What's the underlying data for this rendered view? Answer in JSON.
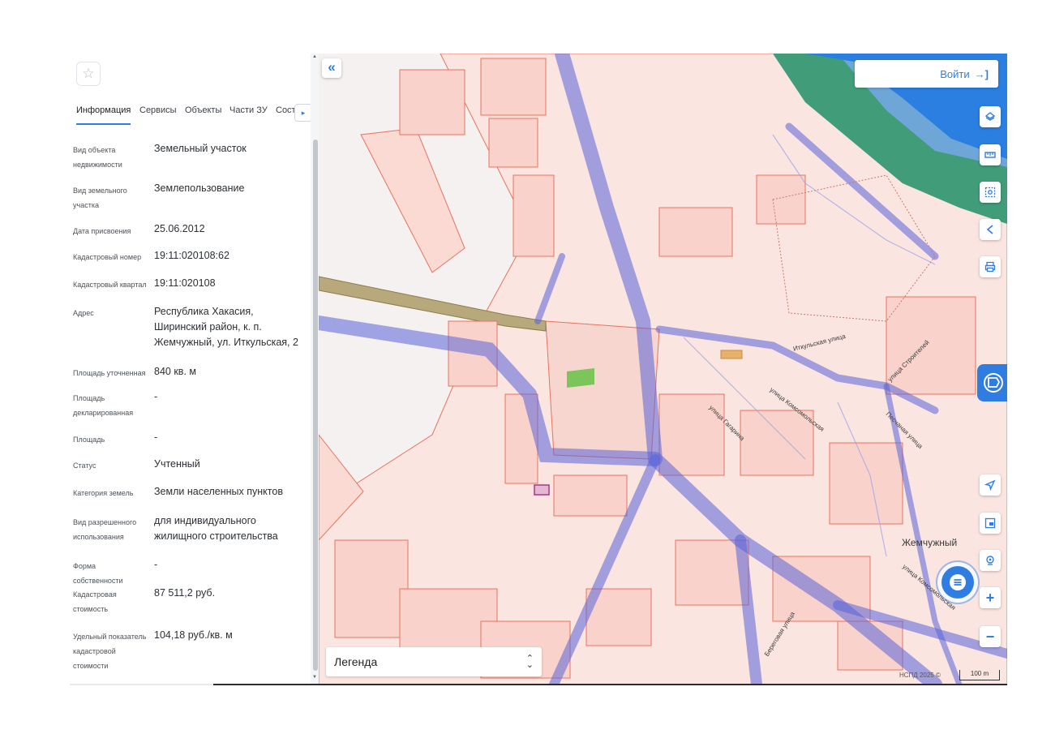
{
  "panel": {
    "tabs": [
      "Информация",
      "Сервисы",
      "Объекты",
      "Части ЗУ",
      "Состав"
    ],
    "active_tab": "Информация",
    "attributes": [
      {
        "label": "Вид объекта недвижимости",
        "value": "Земельный участок"
      },
      {
        "label": "Вид земельного участка",
        "value": "Землепользование"
      },
      {
        "label": "Дата присвоения",
        "value": "25.06.2012"
      },
      {
        "label": "Кадастровый номер",
        "value": "19:11:020108:62"
      },
      {
        "label": "Кадастровый квартал",
        "value": "19:11:020108"
      },
      {
        "label": "Адрес",
        "value": "Республика Хакасия, Ширинский район, к. п. Жемчужный, ул. Иткульская, 2"
      },
      {
        "label": "Площадь уточненная",
        "value": "840 кв. м"
      },
      {
        "label": "Площадь декларированная",
        "value": "-"
      },
      {
        "label": "Площадь",
        "value": "-"
      },
      {
        "label": "Статус",
        "value": "Учтенный"
      },
      {
        "label": "Категория земель",
        "value": "Земли населенных пунктов"
      },
      {
        "label": "Вид разрешенного использования",
        "value": "для индивидуального жилищного строительства"
      },
      {
        "label": "Форма собственности",
        "value": "-"
      },
      {
        "label": "Кадастровая стоимость",
        "value": "87 511,2 руб."
      },
      {
        "label": "Удельный показатель кадастровой стоимости",
        "value": "104,18 руб./кв. м"
      }
    ]
  },
  "map": {
    "login_label": "Войти",
    "legend_label": "Легенда",
    "attribution": "НСПД 2025 ©",
    "scale_label": "100 m",
    "place_label": "Жемчужный",
    "street_labels": [
      "Иткульская улица",
      "улица Строителей",
      "улица Гагарина",
      "улица Комсомольская",
      "Песчаная улица",
      "улица Комсомольская",
      "Береговая улица"
    ],
    "tools": [
      "layers-icon",
      "ruler-icon",
      "select-area-icon",
      "share-icon",
      "print-icon",
      "geolocation-icon",
      "square-select-icon",
      "search-location-icon",
      "zoom-in-icon",
      "zoom-out-icon"
    ],
    "colors": {
      "accent": "#2f7de1",
      "parcel_fill": "#f9d9d2",
      "parcel_stroke": "#e8735f",
      "road": "#5a63d8",
      "water": "#2a7fe0"
    }
  }
}
